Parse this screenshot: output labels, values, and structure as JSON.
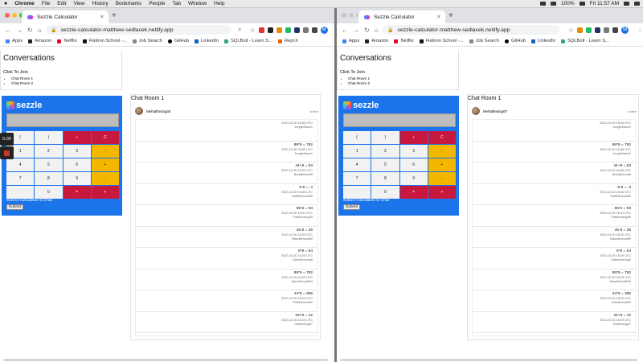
{
  "menubar": {
    "app": "Chrome",
    "items": [
      "File",
      "Edit",
      "View",
      "History",
      "Bookmarks",
      "People",
      "Tab",
      "Window",
      "Help"
    ],
    "battery": "100%",
    "clock": "Fri 11:57 AM"
  },
  "browser": {
    "tab_title": "Sezzle Calculator",
    "url": "sezzle-calculator-matthew-sedlacek.netlify.app",
    "bookmarks": [
      "Apps",
      "Amazon",
      "Netflix",
      "Flatiron School -...",
      "Job Search",
      "GitHub",
      "LinkedIn",
      "SQLBolt - Learn S...",
      "Repl.it"
    ],
    "profile_initial": "M"
  },
  "page": {
    "conv_title": "Conversations",
    "join_label": "Click To Join",
    "rooms": [
      "Chat Room 1",
      "Chat Room 2"
    ],
    "calc_logo": "sezzle",
    "keys": [
      "(",
      ")",
      "÷",
      "C",
      "1",
      "2",
      "3",
      "-",
      "4",
      "5",
      "6",
      "+",
      "7",
      "8",
      "9",
      "-",
      "",
      "0",
      "=",
      "+"
    ],
    "submit_label": "Submit Calculation to Chat.",
    "submit_button": "Submit"
  },
  "recorder": {
    "time": "5:00"
  },
  "left": {
    "chat_title": "Chat Room 1",
    "user": "Mehtalhedog35",
    "status": "online",
    "messages": [
      {
        "text": "",
        "time": "2020-10-30 18:30 UTC",
        "user": "Junglethanz1"
      },
      {
        "text": "88*9 = 792",
        "time": "2020-10-30 18:30 UTC",
        "user": "Junglethanz1"
      },
      {
        "text": "44+9 = 53",
        "time": "2020-10-30 18:30 UTC",
        "user": "Buddythecat9"
      },
      {
        "text": "5-9 = -4",
        "time": "2020-10-30 18:30 UTC",
        "user": "Swiftiethecat00"
      },
      {
        "text": "89-6 = 93",
        "time": "2020-10-30 18:31 UTC",
        "user": "Pantheodog39"
      },
      {
        "text": "45-9 = 36",
        "time": "2020-10-30 18:30 UTC",
        "user": "Biscuitthecat00"
      },
      {
        "text": "6*9 = 54",
        "time": "2020-10-30 18:29 UTC",
        "user": "Darkinthedog5"
      },
      {
        "text": "88*9 = 792",
        "time": "2020-10-30 18:29 UTC",
        "user": "Jasonthecat994"
      },
      {
        "text": "44*9 = 396",
        "time": "2020-10-30 18:29 UTC",
        "user": "Pillowthecat00"
      },
      {
        "text": "33+9 = 42",
        "time": "2020-10-30 18:29 UTC",
        "user": "Ollathedog67"
      }
    ]
  },
  "right": {
    "chat_title": "Chat Room 1",
    "user": "Mehtalhedog67",
    "status": "online",
    "messages": [
      {
        "text": "",
        "time": "2020-10-30 18:36 UTC",
        "user": "Junglethanz1"
      },
      {
        "text": "88*9 = 792",
        "time": "2020-10-30 18:36 UTC",
        "user": "Junglethanz1"
      },
      {
        "text": "44+9 = 53",
        "time": "2020-10-30 18:36 UTC",
        "user": "Buddythecat9"
      },
      {
        "text": "5-9 = -4",
        "time": "2020-10-30 18:36 UTC",
        "user": "Swiftiethecat00"
      },
      {
        "text": "89-6 = 93",
        "time": "2020-10-30 18:31 UTC",
        "user": "Pantheodog39"
      },
      {
        "text": "45-9 = 36",
        "time": "2020-10-30 18:30 UTC",
        "user": "Biscuitthecat00"
      },
      {
        "text": "6*9 = 54",
        "time": "2020-10-30 18:29 UTC",
        "user": "Darkinthedog5"
      },
      {
        "text": "88*9 = 792",
        "time": "2020-10-30 18:29 UTC",
        "user": "Jasonthecat994"
      },
      {
        "text": "44*9 = 396",
        "time": "2020-10-30 18:29 UTC",
        "user": "Pillowthecat00"
      },
      {
        "text": "33+9 = 42",
        "time": "2020-10-30 18:29 UTC",
        "user": "Ollathedog67"
      }
    ]
  }
}
